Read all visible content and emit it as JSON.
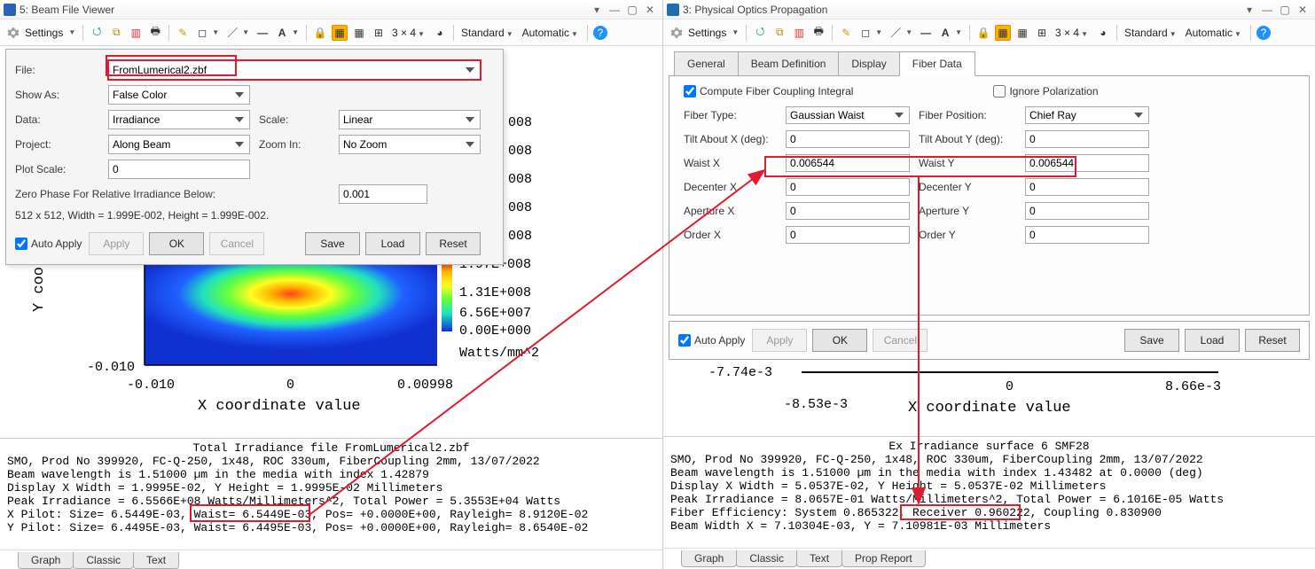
{
  "left": {
    "titlebar": {
      "title": "5: Beam File Viewer"
    },
    "toolbar": {
      "settings_label": "Settings",
      "grid_label": "3 × 4",
      "mode1": "Standard",
      "mode2": "Automatic"
    },
    "settings": {
      "file_label": "File:",
      "file_value": "FromLumerical2.zbf",
      "showas_label": "Show As:",
      "showas_value": "False Color",
      "data_label": "Data:",
      "data_value": "Irradiance",
      "scale_label": "Scale:",
      "scale_value": "Linear",
      "project_label": "Project:",
      "project_value": "Along Beam",
      "zoom_label": "Zoom In:",
      "zoom_value": "No Zoom",
      "plotscale_label": "Plot Scale:",
      "plotscale_value": "0",
      "zerophase_label": "Zero Phase For Relative Irradiance Below:",
      "zerophase_value": "0.001",
      "dims_line": "512 x 512, Width = 1.999E-002, Height = 1.999E-002.",
      "autoapply_label": "Auto Apply",
      "apply_btn": "Apply",
      "ok_btn": "OK",
      "cancel_btn": "Cancel",
      "save_btn": "Save",
      "load_btn": "Load",
      "reset_btn": "Reset"
    },
    "chart": {
      "y_axis_label": "Y coo",
      "x_axis_label": "X coordinate value",
      "x_ticks": [
        "-0.010",
        "0",
        "0.00998"
      ],
      "y_tick": "-0.010",
      "cbar_ticks": [
        "008",
        "008",
        "008",
        "008",
        "008",
        "1.97E+008",
        "1.31E+008",
        "6.56E+007",
        "0.00E+000"
      ],
      "cbar_units": "Watts/mm^2"
    },
    "text": {
      "title": "Total Irradiance file FromLumerical2.zbf",
      "lines": [
        "SMO, Prod No 399920, FC-Q-250, 1x48, ROC 330um, FiberCoupling 2mm, 13/07/2022",
        "Beam wavelength is 1.51000 µm in the media with index 1.42879",
        "Display X Width = 1.9995E-02, Y Height = 1.9995E-02 Millimeters",
        "Peak Irradiance = 6.5566E+08 Watts/Millimeters^2, Total Power = 5.3553E+04 Watts",
        "X Pilot: Size= 6.5449E-03, Waist= 6.5449E-03, Pos= +0.0000E+00, Rayleigh= 8.9120E-02",
        "Y Pilot: Size= 6.4495E-03, Waist= 6.4495E-03, Pos= +0.0000E+00, Rayleigh= 8.6540E-02"
      ],
      "highlight_text": "Waist= 6.5449E-03,"
    },
    "tabs": [
      "Graph",
      "Classic",
      "Text"
    ]
  },
  "right": {
    "titlebar": {
      "title": "3: Physical Optics Propagation"
    },
    "toolbar": {
      "settings_label": "Settings",
      "grid_label": "3 × 4",
      "mode1": "Standard",
      "mode2": "Automatic"
    },
    "tabs": [
      "General",
      "Beam Definition",
      "Display",
      "Fiber Data"
    ],
    "top": {
      "compute_label": "Compute Fiber Coupling Integral",
      "ignore_label": "Ignore Polarization"
    },
    "form": {
      "fibertype_label": "Fiber Type:",
      "fibertype_value": "Gaussian Waist",
      "fiberpos_label": "Fiber Position:",
      "fiberpos_value": "Chief Ray",
      "tiltx_label": "Tilt About X (deg):",
      "tiltx_value": "0",
      "tilty_label": "Tilt About Y (deg):",
      "tilty_value": "0",
      "waistx_label": "Waist X",
      "waistx_value": "0.006544",
      "waisty_label": "Waist Y",
      "waisty_value": "0.006544",
      "decx_label": "Decenter X",
      "decx_value": "0",
      "decy_label": "Decenter Y",
      "decy_value": "0",
      "apx_label": "Aperture X",
      "apx_value": "0",
      "apy_label": "Aperture Y",
      "apy_value": "0",
      "ordx_label": "Order X",
      "ordx_value": "0",
      "ordy_label": "Order Y",
      "ordy_value": "0"
    },
    "footer": {
      "autoapply_label": "Auto Apply",
      "apply_btn": "Apply",
      "ok_btn": "OK",
      "cancel_btn": "Cancel",
      "save_btn": "Save",
      "load_btn": "Load",
      "reset_btn": "Reset"
    },
    "chart": {
      "x_axis_label": "X coordinate value",
      "ticks": [
        "-8.53e-3",
        "0",
        "8.66e-3"
      ],
      "left_trunc": "-7.74e-3"
    },
    "text": {
      "title": "Ex Irradiance surface 6 SMF28",
      "lines": [
        "SMO, Prod No 399920, FC-Q-250, 1x48, ROC 330um, FiberCoupling 2mm, 13/07/2022",
        "Beam wavelength is 1.51000 µm in the media with index 1.43482 at 0.0000 (deg)",
        "Display X Width = 5.0537E-02, Y Height = 5.0537E-02 Millimeters",
        "Peak Irradiance = 8.0657E-01 Watts/Millimeters^2, Total Power = 6.1016E-05 Watts",
        "Fiber Efficiency: System 0.865322, Receiver 0.960222, Coupling 0.830900",
        "Beam Width X = 7.10304E-03, Y = 7.10981E-03 Millimeters"
      ],
      "highlight_text": "Receiver 0.960222,"
    },
    "tabs_bottom": [
      "Graph",
      "Classic",
      "Text",
      "Prop Report"
    ]
  },
  "icons": {
    "gear": "⚙",
    "refresh": "🔄",
    "copy": "📋",
    "chart": "📊",
    "printer": "🖨",
    "pencil": "✎",
    "square": "□",
    "line": "／",
    "arrow": "↔",
    "text": "A",
    "lock": "🔒",
    "grid1": "▦",
    "grid2": "▦",
    "grid3": "⊞",
    "clock": "◐",
    "help": "?"
  }
}
